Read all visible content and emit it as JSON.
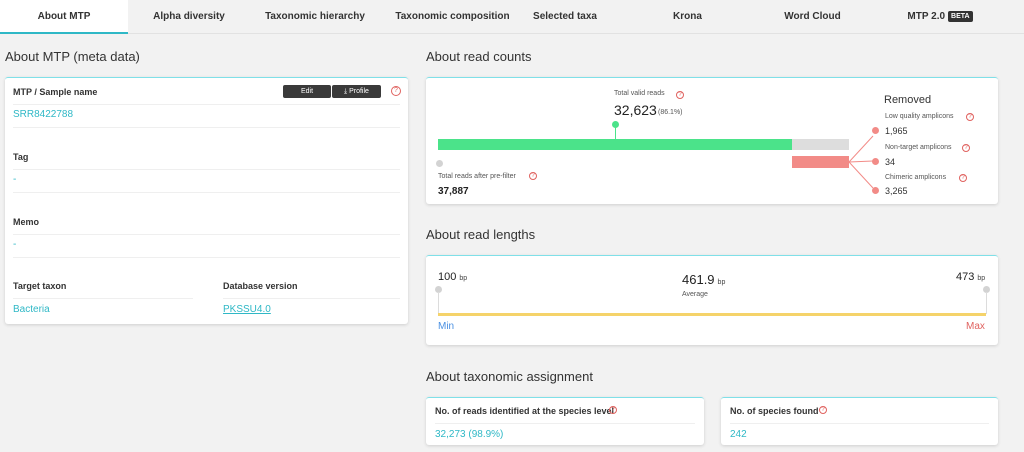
{
  "tabs": [
    {
      "label": "About MTP"
    },
    {
      "label": "Alpha diversity"
    },
    {
      "label": "Taxonomic hierarchy"
    },
    {
      "label": "Taxonomic composition"
    },
    {
      "label": "Selected taxa"
    },
    {
      "label": "Krona"
    },
    {
      "label": "Word Cloud"
    },
    {
      "label": "MTP 2.0",
      "badge": "BETA"
    }
  ],
  "meta": {
    "title": "About MTP (meta data)",
    "sample_label": "MTP / Sample name",
    "sample_value": "SRR8422788",
    "edit_label": "Edit",
    "profile_label": "Profile",
    "tag_label": "Tag",
    "tag_value": "-",
    "memo_label": "Memo",
    "memo_value": "-",
    "target_label": "Target taxon",
    "target_value": "Bacteria",
    "db_label": "Database version",
    "db_value": "PKSSU4.0"
  },
  "read_counts": {
    "title": "About read counts",
    "valid_label": "Total valid reads",
    "valid_value": "32,623",
    "valid_pct": "(86.1%)",
    "valid_fraction": 0.861,
    "prefilter_label": "Total reads after pre-filter",
    "prefilter_value": "37,887",
    "removed_title": "Removed",
    "removed": [
      {
        "label": "Low quality amplicons",
        "value": "1,965"
      },
      {
        "label": "Non-target amplicons",
        "value": "34"
      },
      {
        "label": "Chimeric amplicons",
        "value": "3,265"
      }
    ]
  },
  "read_lengths": {
    "title": "About read lengths",
    "min": "100",
    "max": "473",
    "avg": "461.9",
    "unit": "bp",
    "avg_label": "Average",
    "min_label": "Min",
    "max_label": "Max"
  },
  "taxonomic": {
    "title": "About taxonomic assignment",
    "species_reads_label": "No. of reads identified at the species level",
    "species_reads_value": "32,273 (98.9%)",
    "species_found_label": "No. of species found",
    "species_found_value": "242"
  },
  "colors": {
    "accent": "#2fb8c6",
    "valid_green": "#4be38a",
    "removed_red": "#f28b87",
    "bar_gray": "#dddddd",
    "length_bar": "#f5d36a"
  }
}
